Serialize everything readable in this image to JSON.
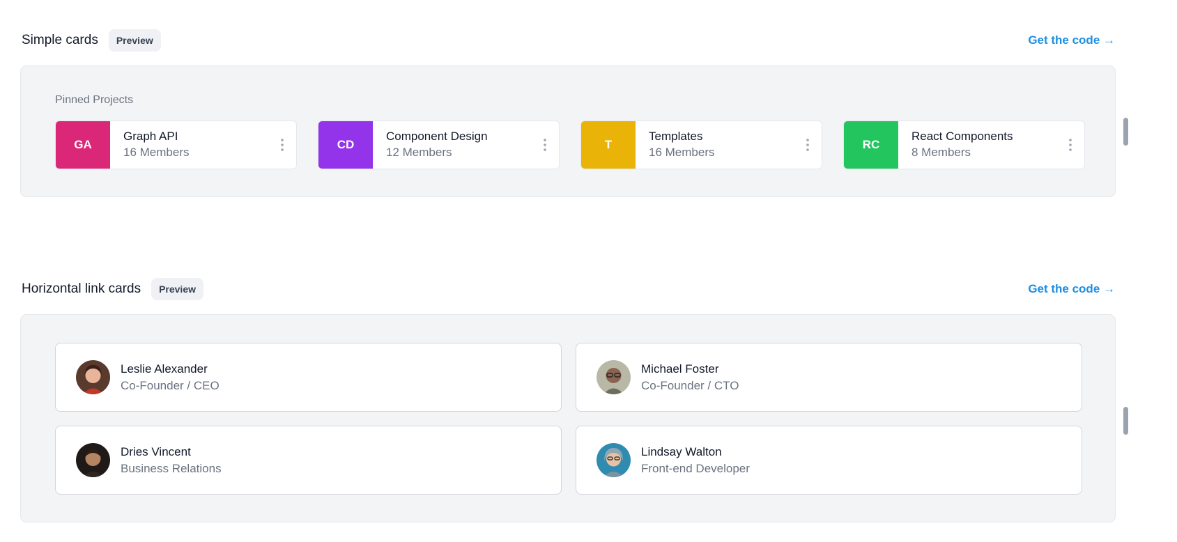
{
  "simple_cards": {
    "title": "Simple cards",
    "badge": "Preview",
    "get_code": "Get the code →",
    "pinned_label": "Pinned Projects",
    "projects": [
      {
        "initials": "GA",
        "name": "Graph API",
        "members": "16 Members",
        "color": "#db2777"
      },
      {
        "initials": "CD",
        "name": "Component Design",
        "members": "12 Members",
        "color": "#9333ea"
      },
      {
        "initials": "T",
        "name": "Templates",
        "members": "16 Members",
        "color": "#eab308"
      },
      {
        "initials": "RC",
        "name": "React Components",
        "members": "8 Members",
        "color": "#22c55e"
      }
    ]
  },
  "horizontal_link_cards": {
    "title": "Horizontal link cards",
    "badge": "Preview",
    "get_code": "Get the code →",
    "people": [
      {
        "name": "Leslie Alexander",
        "role": "Co-Founder / CEO"
      },
      {
        "name": "Michael Foster",
        "role": "Co-Founder / CTO"
      },
      {
        "name": "Dries Vincent",
        "role": "Business Relations"
      },
      {
        "name": "Lindsay Walton",
        "role": "Front-end Developer"
      }
    ]
  },
  "colors": {
    "accent_link": "#1d8fe3",
    "panel_bg": "#f3f4f6",
    "muted_text": "#6b7280"
  }
}
